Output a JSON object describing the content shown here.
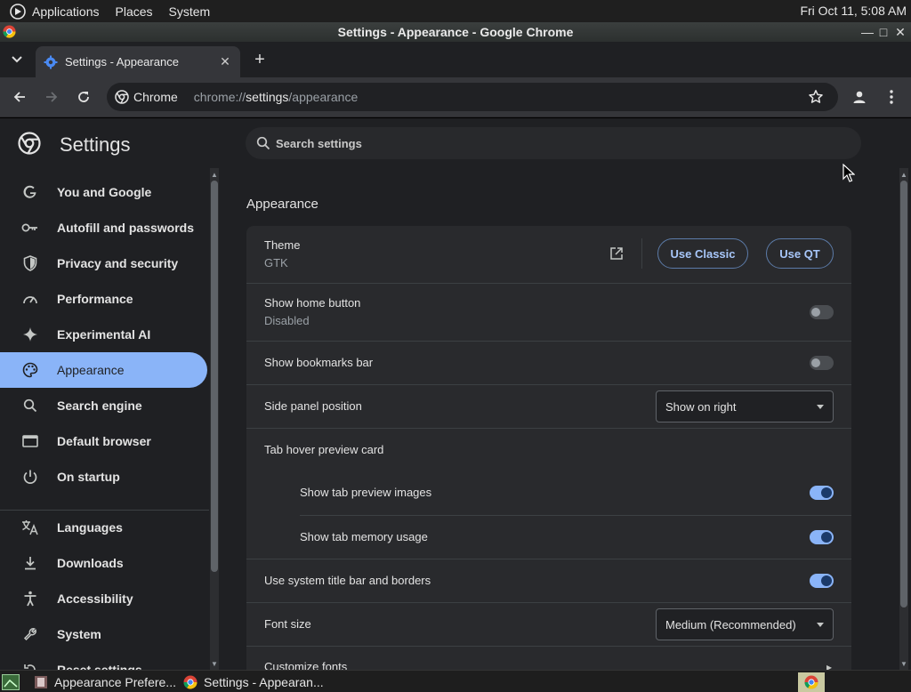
{
  "panel": {
    "menus": [
      "Applications",
      "Places",
      "System"
    ],
    "clock": "Fri Oct 11,  5:08 AM"
  },
  "window": {
    "title": "Settings - Appearance - Google Chrome"
  },
  "tab": {
    "title": "Settings - Appearance",
    "close": "✕",
    "new_tab": "+"
  },
  "omnibox": {
    "site_name": "Chrome",
    "url_prefix": "chrome://",
    "url_host": "settings",
    "url_path": "/appearance"
  },
  "settings": {
    "title": "Settings",
    "search_placeholder": "Search settings",
    "nav": [
      {
        "label": "You and Google",
        "icon": "google-g-icon"
      },
      {
        "label": "Autofill and passwords",
        "icon": "key-icon"
      },
      {
        "label": "Privacy and security",
        "icon": "shield-icon"
      },
      {
        "label": "Performance",
        "icon": "speedometer-icon"
      },
      {
        "label": "Experimental AI",
        "icon": "sparkle-icon"
      },
      {
        "label": "Appearance",
        "icon": "palette-icon",
        "active": true
      },
      {
        "label": "Search engine",
        "icon": "search-icon"
      },
      {
        "label": "Default browser",
        "icon": "browser-window-icon"
      },
      {
        "label": "On startup",
        "icon": "power-icon"
      },
      {
        "label": "Languages",
        "icon": "translate-icon"
      },
      {
        "label": "Downloads",
        "icon": "download-icon"
      },
      {
        "label": "Accessibility",
        "icon": "accessibility-icon"
      },
      {
        "label": "System",
        "icon": "wrench-icon"
      },
      {
        "label": "Reset settings",
        "icon": "reset-icon"
      }
    ]
  },
  "appearance": {
    "section_title": "Appearance",
    "theme_label": "Theme",
    "theme_value": "GTK",
    "use_classic": "Use Classic",
    "use_qt": "Use QT",
    "show_home_label": "Show home button",
    "show_home_value": "Disabled",
    "show_home_on": false,
    "show_bookmarks_label": "Show bookmarks bar",
    "show_bookmarks_on": false,
    "side_panel_label": "Side panel position",
    "side_panel_value": "Show on right",
    "tab_hover_label": "Tab hover preview card",
    "tab_preview_images_label": "Show tab preview images",
    "tab_preview_images_on": true,
    "tab_memory_label": "Show tab memory usage",
    "tab_memory_on": true,
    "system_titlebar_label": "Use system title bar and borders",
    "system_titlebar_on": true,
    "font_size_label": "Font size",
    "font_size_value": "Medium (Recommended)",
    "customize_fonts_label": "Customize fonts"
  },
  "taskbar": {
    "items": [
      "Appearance Prefere...",
      "Settings - Appearan..."
    ]
  },
  "colors": {
    "accent": "#8ab4f8",
    "background": "#1f2023",
    "card": "#292a2d"
  }
}
